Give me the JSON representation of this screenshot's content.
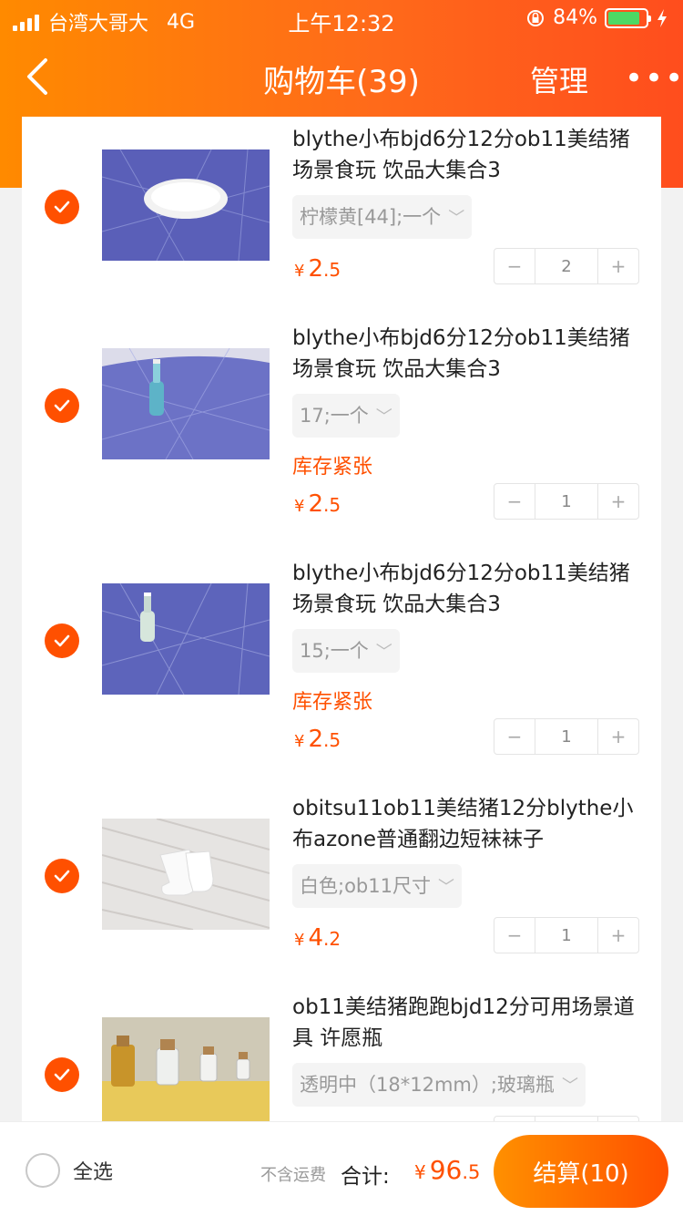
{
  "status_bar": {
    "carrier": "台湾大哥大",
    "network": "4G",
    "time": "上午12:32",
    "battery": "84%"
  },
  "nav": {
    "title": "购物车(39)",
    "manage": "管理",
    "more": "•••"
  },
  "items": [
    {
      "title": "blythe小布bjd6分12分ob11美结猪场景食玩 饮品大集合3",
      "sku": "柠檬黄[44];一个",
      "stock": "",
      "price_int": "2",
      "price_dec": ".5",
      "qty": "2",
      "checked": true,
      "image": "white-plate"
    },
    {
      "title": "blythe小布bjd6分12分ob11美结猪场景食玩 饮品大集合3",
      "sku": "17;一个",
      "stock": "库存紧张",
      "price_int": "2",
      "price_dec": ".5",
      "qty": "1",
      "checked": true,
      "image": "blue-bottle"
    },
    {
      "title": "blythe小布bjd6分12分ob11美结猪场景食玩 饮品大集合3",
      "sku": "15;一个",
      "stock": "库存紧张",
      "price_int": "2",
      "price_dec": ".5",
      "qty": "1",
      "checked": true,
      "image": "clear-bottle"
    },
    {
      "title": "obitsu11ob11美结猪12分blythe小布azone普通翻边短袜袜子",
      "sku": "白色;ob11尺寸",
      "stock": "",
      "price_int": "4",
      "price_dec": ".2",
      "qty": "1",
      "checked": true,
      "image": "white-socks"
    },
    {
      "title": "ob11美结猪跑跑bjd12分可用场景道具 许愿瓶",
      "sku": "透明中（18*12mm）;玻璃瓶",
      "stock": "",
      "price_int": "",
      "price_dec": "",
      "qty": "",
      "checked": true,
      "image": "wish-bottles"
    }
  ],
  "currency": "¥",
  "footer": {
    "select_all": "全选",
    "shipping_note": "不含运费",
    "total_label": "合计:",
    "total_int": "96",
    "total_dec": ".5",
    "checkout": "结算(10)"
  },
  "colors": {
    "brand": "#ff5000",
    "header_start": "#ff8a00",
    "header_end": "#ff4d1d",
    "battery": "#4cd964"
  },
  "icons": [
    "back-chevron-icon",
    "checkmark-icon",
    "chevron-down-icon",
    "minus-icon",
    "plus-icon",
    "rotation-lock-icon",
    "charging-icon"
  ]
}
